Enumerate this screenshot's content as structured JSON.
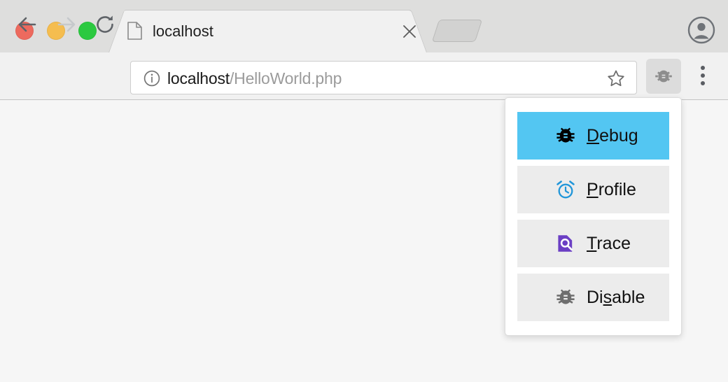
{
  "window": {
    "controls": [
      {
        "name": "close",
        "color": "#ed6a5e"
      },
      {
        "name": "minimize",
        "color": "#f5bd4f"
      },
      {
        "name": "maximize",
        "color": "#2bc940"
      }
    ]
  },
  "tabstrip": {
    "active_tab": {
      "title": "localhost",
      "favicon": "page-icon",
      "close_label": "×"
    },
    "new_tab_button": "new-tab",
    "avatar": "account-avatar"
  },
  "toolbar": {
    "back": "back-arrow",
    "forward": "forward-arrow",
    "reload": "reload",
    "omnibox": {
      "info_icon": "info-circle-icon",
      "host": "localhost",
      "path": "/HelloWorld.php",
      "star_icon": "bookmark-star-icon"
    },
    "extension_button": {
      "icon": "bug-gear-icon",
      "active": true
    },
    "menu_button": "three-dot-menu"
  },
  "popup_menu": {
    "items": [
      {
        "label_before": "",
        "accel": "D",
        "label_after": "ebug",
        "icon": "bug-icon",
        "icon_color": "#000000",
        "selected": true
      },
      {
        "label_before": "",
        "accel": "P",
        "label_after": "rofile",
        "icon": "alarm-clock-icon",
        "icon_color": "#2196d9",
        "selected": false
      },
      {
        "label_before": "",
        "accel": "T",
        "label_after": "race",
        "icon": "document-search-icon",
        "icon_color": "#6b3fc4",
        "selected": false
      },
      {
        "label_before": "Di",
        "accel": "s",
        "label_after": "able",
        "icon": "bug-icon",
        "icon_color": "#6e6e6e",
        "selected": false
      }
    ],
    "selected_color": "#53c6f2",
    "item_color": "#ececec"
  },
  "page": {
    "background": "#f6f6f6",
    "body_text": ""
  }
}
